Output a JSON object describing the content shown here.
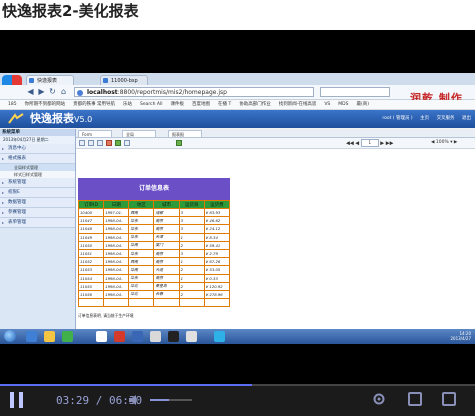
{
  "heading": "快逸报表2-美化报表",
  "browser": {
    "tabs": [
      "快逸报表",
      "11000-bsp"
    ],
    "address_host": "localhost",
    "address_path": ":8800/reportmis/mis2/homepage.jsp",
    "bookmarks": [
      "185",
      "你所期不到都的网站",
      "贵都的铁事 常用导航",
      "乐站",
      "Search All",
      "课件板",
      "百度地图",
      "在播 T",
      "协助高部门作业",
      "找到新闻-在线高思",
      "VS",
      "MDS",
      "最(商)"
    ],
    "watermark": "润乾 制作"
  },
  "app": {
    "title": "快逸报表",
    "version": "V5.0",
    "header_right": [
      "root ( 管理员 )",
      "主页",
      "交叉服务",
      "退出"
    ]
  },
  "sidebar": {
    "head": "系统菜单",
    "date": "2013年04月27日 星期二",
    "items": [
      {
        "label": "消息中心",
        "subs": []
      },
      {
        "label": "格式报表",
        "subs": [
          "全局样式管理",
          "样式日样式管理"
        ]
      },
      {
        "label": "系统管理",
        "subs": []
      },
      {
        "label": "权限E",
        "subs": []
      },
      {
        "label": "数据管理",
        "subs": []
      },
      {
        "label": "参赛管理",
        "subs": []
      },
      {
        "label": "表单管理",
        "subs": []
      }
    ]
  },
  "main": {
    "tabs": [
      "Form",
      "全局",
      "报表报"
    ],
    "pager": {
      "current": "1",
      "label": "◀ ◀  1  ▶ ▶"
    },
    "zoom": "100%"
  },
  "report": {
    "title": "订单信息表",
    "columns": [
      "订单ID",
      "日期",
      "地区",
      "城市",
      "运货商",
      "运货费"
    ],
    "rows": [
      [
        "10400",
        "1997-01-",
        "西南",
        "成都",
        "3",
        "¥ 83.93"
      ],
      [
        "11047",
        "1998-04-",
        "华东",
        "南京",
        "3",
        "¥ 46.62"
      ],
      [
        "11048",
        "1998-04-",
        "华东",
        "南京",
        "3",
        "¥ 24.12"
      ],
      [
        "11049",
        "1998-04-",
        "华东",
        "天津",
        "1",
        "¥ 8.34"
      ],
      [
        "11050",
        "1998-04-",
        "华南",
        "厦门",
        "2",
        "¥ 59.41"
      ],
      [
        "11051",
        "1998-04-",
        "华东",
        "南京",
        "3",
        "¥ 2.79"
      ],
      [
        "11052",
        "1998-04-",
        "西南",
        "南京",
        "1",
        "¥ 67.26"
      ],
      [
        "11053",
        "1998-04-",
        "华南",
        "大连",
        "2",
        "¥ 53.05"
      ],
      [
        "11054",
        "1998-04-",
        "华东",
        "南京",
        "1",
        "¥ 0.33"
      ],
      [
        "11055",
        "1998-04-",
        "华北",
        "秦皇岛",
        "2",
        "¥ 120.92"
      ],
      [
        "11056",
        "1998-04-",
        "华北",
        "长春",
        "2",
        "¥ 278.96"
      ],
      [
        "",
        "",
        "",
        "",
        "",
        ""
      ]
    ],
    "footer": "订单信息表明, 请当前于生产环境"
  },
  "taskbar": {
    "time": "14:20",
    "date": "2013/4/27"
  },
  "player": {
    "time": "03:29 / 06:30",
    "progress_fraction": 0.53,
    "volume_fraction": 0.45
  }
}
